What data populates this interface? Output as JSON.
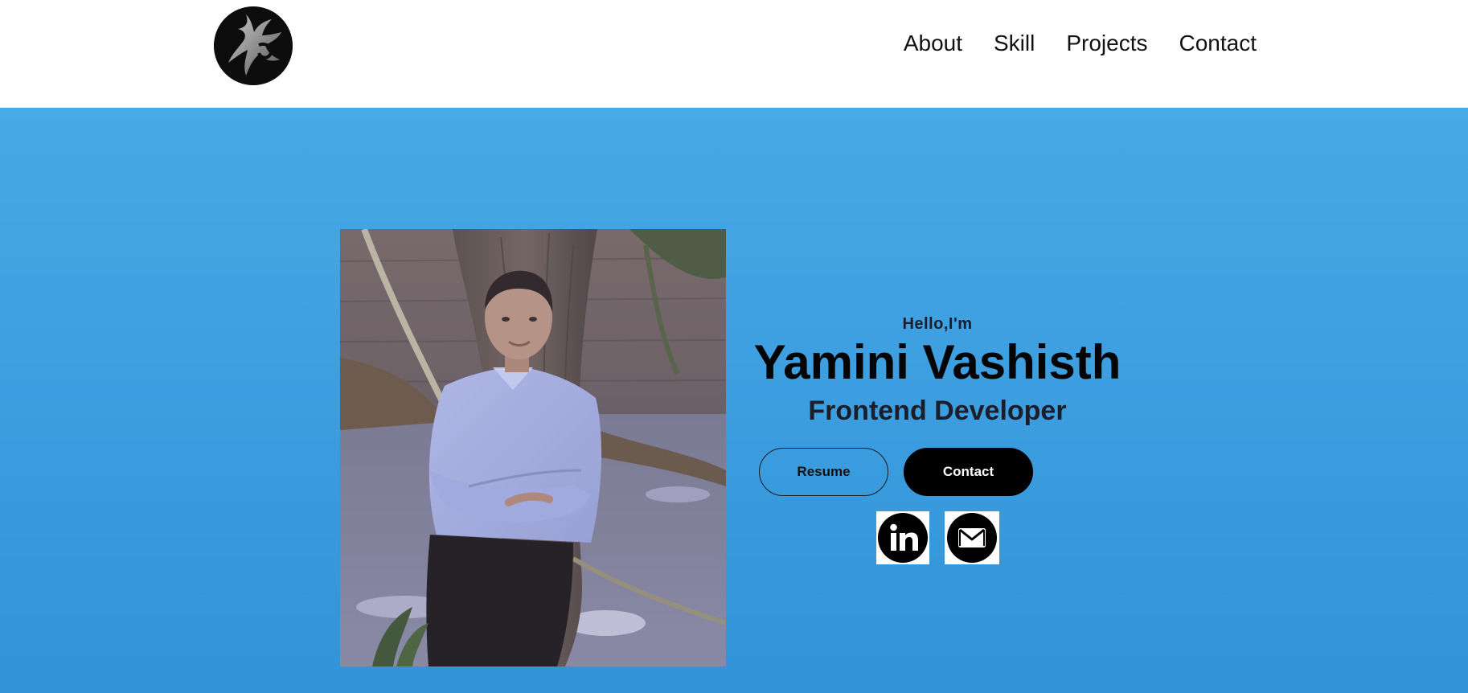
{
  "nav": {
    "logo_icon": "logo-icon",
    "links": [
      "About",
      "Skill",
      "Projects",
      "Contact"
    ]
  },
  "hero": {
    "greeting": "Hello,I'm",
    "name": "Yamini Vashisth",
    "role": "Frontend Developer",
    "buttons": {
      "resume": "Resume",
      "contact": "Contact"
    },
    "socials": [
      {
        "icon": "linkedin-icon"
      },
      {
        "icon": "mail-icon"
      }
    ]
  },
  "colors": {
    "hero_bg_top": "#47a9e6",
    "hero_bg_bottom": "#3194d8",
    "text_dark": "#1b1e2a",
    "button_solid": "#000000"
  }
}
